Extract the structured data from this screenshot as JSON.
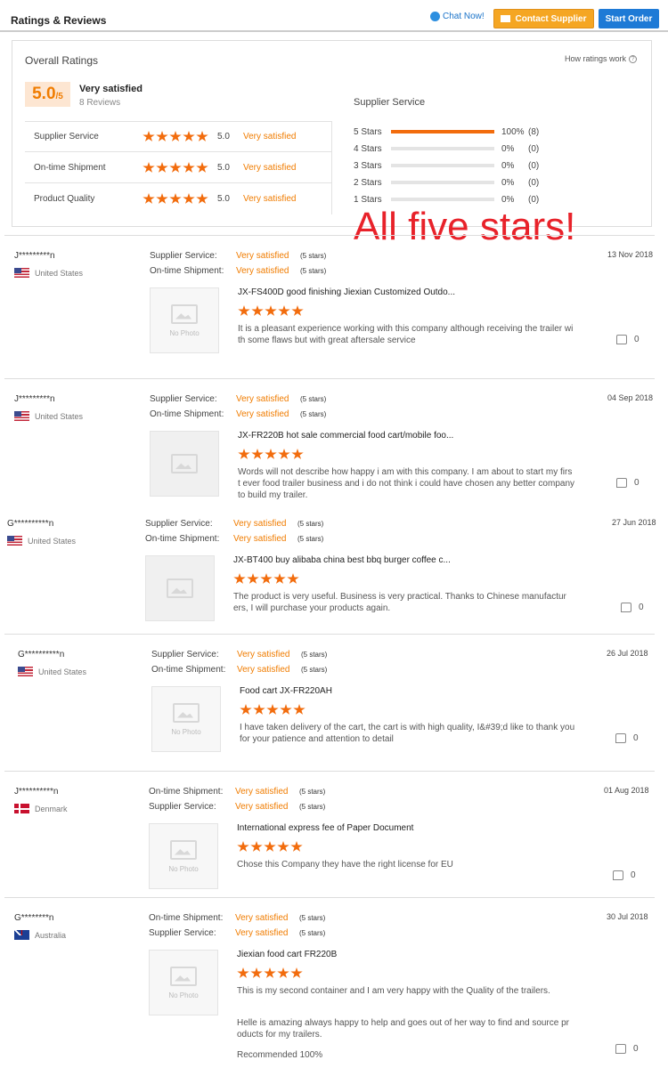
{
  "header": {
    "title": "Ratings & Reviews",
    "chat_label": "Chat Now!",
    "contact_label": "Contact Supplier",
    "order_label": "Start Order"
  },
  "overall": {
    "title": "Overall Ratings",
    "how_label": "How ratings work",
    "score": "5.0",
    "score_suffix": "/5",
    "summary": "Very satisfied",
    "reviews": "8 Reviews",
    "metrics": [
      {
        "label": "Supplier Service",
        "score": "5.0",
        "value": "Very satisfied",
        "stars": 5
      },
      {
        "label": "On-time Shipment",
        "score": "5.0",
        "value": "Very satisfied",
        "stars": 5
      },
      {
        "label": "Product Quality",
        "score": "5.0",
        "value": "Very satisfied",
        "stars": 5
      }
    ],
    "service_title": "Supplier Service",
    "distribution": [
      {
        "label": "5  Stars",
        "fraction": 1.0,
        "pct": "100%",
        "count": "(8)"
      },
      {
        "label": "4  Stars",
        "fraction": 0,
        "pct": "0%",
        "count": "(0)"
      },
      {
        "label": "3  Stars",
        "fraction": 0,
        "pct": "0%",
        "count": "(0)"
      },
      {
        "label": "2  Stars",
        "fraction": 0,
        "pct": "0%",
        "count": "(0)"
      },
      {
        "label": "1  Stars",
        "fraction": 0,
        "pct": "0%",
        "count": "(0)"
      }
    ]
  },
  "overlay_text": "All five stars!",
  "colors": {
    "accent": "#f07c00",
    "star": "#f26c0d",
    "contact": "#f5a623",
    "order": "#1e7ad6",
    "overlay": "#e8222a"
  },
  "reviews": [
    {
      "name": "J*********n",
      "country": "United States",
      "flag": "us",
      "date": "13 Nov 2018",
      "lines": [
        {
          "label": "Supplier Service:",
          "value": "Very satisfied",
          "stars": "(5 stars)"
        },
        {
          "label": "On-time Shipment:",
          "value": "Very satisfied",
          "stars": "(5 stars)"
        }
      ],
      "photo": "No Photo",
      "product": "JX-FS400D good finishing Jiexian Customized Outdo...",
      "texts": [
        "It is a pleasant experience working with this company although receiving the trailer with some flaws but with great aftersale service"
      ],
      "likes": "0"
    },
    {
      "name": "J*********n",
      "country": "United States",
      "flag": "us",
      "date": "04 Sep 2018",
      "lines": [
        {
          "label": "Supplier Service:",
          "value": "Very satisfied",
          "stars": "(5 stars)"
        },
        {
          "label": "On-time Shipment:",
          "value": "Very satisfied",
          "stars": "(5 stars)"
        }
      ],
      "photo": "",
      "product": "JX-FR220B hot sale commercial food cart/mobile foo...",
      "texts": [
        "Words will not describe how happy i am with this company. I am about to start my first ever food trailer business and i do not think i could have chosen any better company to build my trailer."
      ],
      "likes": "0"
    },
    {
      "name": "G**********n",
      "country": "United States",
      "flag": "us",
      "date": "27 Jun 2018",
      "lines": [
        {
          "label": "Supplier Service:",
          "value": "Very satisfied",
          "stars": "(5 stars)"
        },
        {
          "label": "On-time Shipment:",
          "value": "Very satisfied",
          "stars": "(5 stars)"
        }
      ],
      "photo": "",
      "product": "JX-BT400 buy alibaba china best bbq burger coffee c...",
      "texts": [
        "The product is very useful. Business is very practical. Thanks to Chinese manufacturers, I will purchase your products again."
      ],
      "likes": "0"
    },
    {
      "name": "G**********n",
      "country": "United States",
      "flag": "us",
      "date": "26 Jul 2018",
      "lines": [
        {
          "label": "Supplier Service:",
          "value": "Very satisfied",
          "stars": "(5 stars)"
        },
        {
          "label": "On-time Shipment:",
          "value": "Very satisfied",
          "stars": "(5 stars)"
        }
      ],
      "photo": "No Photo",
      "product": "Food cart JX-FR220AH",
      "texts": [
        "I have taken delivery of the cart, the cart is with high quality, I&#39;d like to thank you for your patience and attention to detail"
      ],
      "likes": "0"
    },
    {
      "name": "J**********n",
      "country": "Denmark",
      "flag": "dk",
      "date": "01 Aug 2018",
      "lines": [
        {
          "label": "On-time Shipment:",
          "value": "Very satisfied",
          "stars": "(5 stars)"
        },
        {
          "label": "Supplier Service:",
          "value": "Very satisfied",
          "stars": "(5 stars)"
        }
      ],
      "photo": "No Photo",
      "product": "International express fee of Paper Document",
      "texts": [
        "Chose this Company they have the right license for EU"
      ],
      "likes": "0"
    },
    {
      "name": "G********n",
      "country": "Australia",
      "flag": "au",
      "date": "30 Jul 2018",
      "lines": [
        {
          "label": "On-time Shipment:",
          "value": "Very satisfied",
          "stars": "(5 stars)"
        },
        {
          "label": "Supplier Service:",
          "value": "Very satisfied",
          "stars": "(5 stars)"
        }
      ],
      "photo": "No Photo",
      "product": "Jiexian food cart FR220B",
      "texts": [
        "This is my second container and I am very happy with the Quality of the trailers.",
        "Helle is amazing always happy to help and goes out of her way to find and source products for my trailers.",
        "Recommended 100%"
      ],
      "likes": "0"
    }
  ]
}
